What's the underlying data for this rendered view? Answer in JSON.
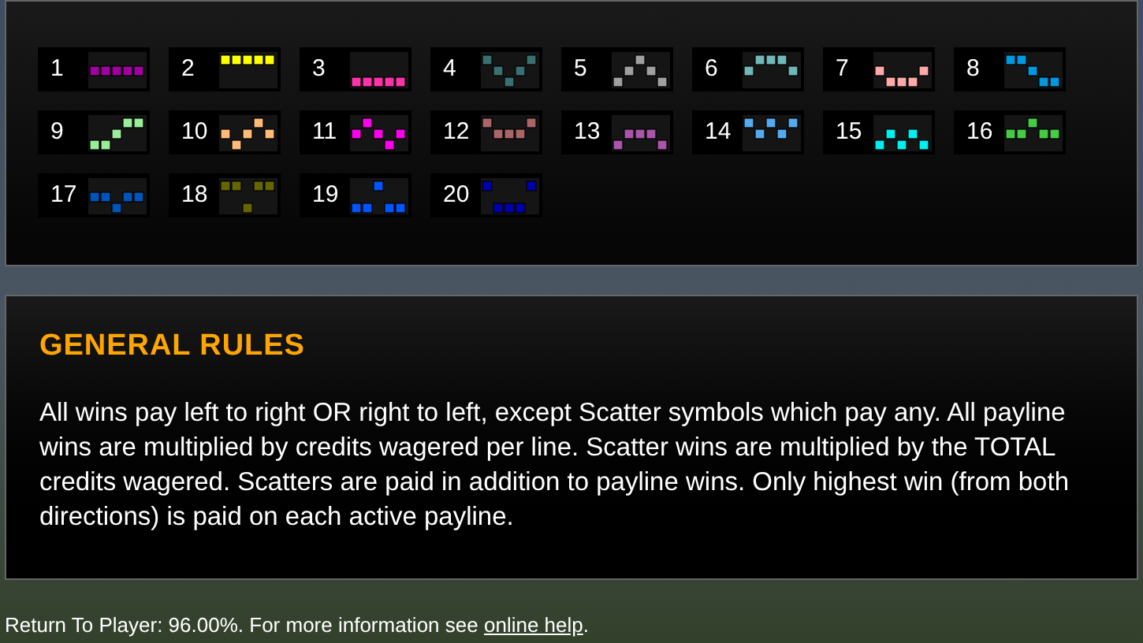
{
  "paylines": [
    {
      "number": "1",
      "color": "#a000a0",
      "squares": [
        {
          "kind": "middle"
        },
        {
          "kind": "middle"
        },
        {
          "kind": "middle"
        },
        {
          "kind": "middle"
        },
        {
          "kind": "middle"
        }
      ]
    },
    {
      "number": "2",
      "color": "#ffff00",
      "squares": [
        {
          "kind": "top"
        },
        {
          "kind": "top"
        },
        {
          "kind": "top"
        },
        {
          "kind": "top"
        },
        {
          "kind": "top"
        }
      ]
    },
    {
      "number": "3",
      "color": "#ff33aa",
      "squares": [
        {
          "kind": "bottom"
        },
        {
          "kind": "bottom"
        },
        {
          "kind": "bottom"
        },
        {
          "kind": "bottom"
        },
        {
          "kind": "bottom"
        }
      ]
    },
    {
      "number": "4",
      "color": "#3a7070",
      "squares": [
        {
          "kind": "top"
        },
        {
          "kind": "middle"
        },
        {
          "kind": "bottom"
        },
        {
          "kind": "middle"
        },
        {
          "kind": "top"
        }
      ]
    },
    {
      "number": "5",
      "color": "#a0a0a0",
      "squares": [
        {
          "kind": "bottom"
        },
        {
          "kind": "middle"
        },
        {
          "kind": "top"
        },
        {
          "kind": "middle"
        },
        {
          "kind": "bottom"
        }
      ]
    },
    {
      "number": "6",
      "color": "#70b8b8",
      "squares": [
        {
          "kind": "middle"
        },
        {
          "kind": "top"
        },
        {
          "kind": "top"
        },
        {
          "kind": "top"
        },
        {
          "kind": "middle"
        }
      ]
    },
    {
      "number": "7",
      "color": "#ffaaaa",
      "squares": [
        {
          "kind": "middle"
        },
        {
          "kind": "bottom"
        },
        {
          "kind": "bottom"
        },
        {
          "kind": "bottom"
        },
        {
          "kind": "middle"
        }
      ]
    },
    {
      "number": "8",
      "color": "#0099e0",
      "squares": [
        {
          "kind": "top"
        },
        {
          "kind": "top"
        },
        {
          "kind": "middle"
        },
        {
          "kind": "bottom"
        },
        {
          "kind": "bottom"
        }
      ]
    },
    {
      "number": "9",
      "color": "#99ee99",
      "squares": [
        {
          "kind": "bottom"
        },
        {
          "kind": "bottom"
        },
        {
          "kind": "middle"
        },
        {
          "kind": "top"
        },
        {
          "kind": "top"
        }
      ]
    },
    {
      "number": "10",
      "color": "#ffbb77",
      "squares": [
        {
          "kind": "middle"
        },
        {
          "kind": "bottom"
        },
        {
          "kind": "middle"
        },
        {
          "kind": "top"
        },
        {
          "kind": "middle"
        }
      ]
    },
    {
      "number": "11",
      "color": "#ff00ee",
      "squares": [
        {
          "kind": "middle"
        },
        {
          "kind": "top"
        },
        {
          "kind": "middle"
        },
        {
          "kind": "bottom"
        },
        {
          "kind": "middle"
        }
      ]
    },
    {
      "number": "12",
      "color": "#aa6666",
      "squares": [
        {
          "kind": "top"
        },
        {
          "kind": "middle"
        },
        {
          "kind": "middle"
        },
        {
          "kind": "middle"
        },
        {
          "kind": "top"
        }
      ]
    },
    {
      "number": "13",
      "color": "#aa55aa",
      "squares": [
        {
          "kind": "bottom"
        },
        {
          "kind": "middle"
        },
        {
          "kind": "middle"
        },
        {
          "kind": "middle"
        },
        {
          "kind": "bottom"
        }
      ]
    },
    {
      "number": "14",
      "color": "#55aaee",
      "squares": [
        {
          "kind": "top"
        },
        {
          "kind": "middle"
        },
        {
          "kind": "top"
        },
        {
          "kind": "middle"
        },
        {
          "kind": "top"
        }
      ]
    },
    {
      "number": "15",
      "color": "#00f0f0",
      "squares": [
        {
          "kind": "bottom"
        },
        {
          "kind": "middle"
        },
        {
          "kind": "bottom"
        },
        {
          "kind": "middle"
        },
        {
          "kind": "bottom"
        }
      ]
    },
    {
      "number": "16",
      "color": "#44cc44",
      "squares": [
        {
          "kind": "middle"
        },
        {
          "kind": "middle"
        },
        {
          "kind": "top"
        },
        {
          "kind": "middle"
        },
        {
          "kind": "middle"
        }
      ]
    },
    {
      "number": "17",
      "color": "#0055bb",
      "squares": [
        {
          "kind": "middle"
        },
        {
          "kind": "middle"
        },
        {
          "kind": "bottom"
        },
        {
          "kind": "middle"
        },
        {
          "kind": "middle"
        }
      ]
    },
    {
      "number": "18",
      "color": "#666600",
      "squares": [
        {
          "kind": "top"
        },
        {
          "kind": "top"
        },
        {
          "kind": "bottom"
        },
        {
          "kind": "top"
        },
        {
          "kind": "top"
        }
      ]
    },
    {
      "number": "19",
      "color": "#0055ff",
      "squares": [
        {
          "kind": "bottom"
        },
        {
          "kind": "bottom"
        },
        {
          "kind": "top"
        },
        {
          "kind": "bottom"
        },
        {
          "kind": "bottom"
        }
      ]
    },
    {
      "number": "20",
      "color": "#0000aa",
      "squares": [
        {
          "kind": "top"
        },
        {
          "kind": "bottom"
        },
        {
          "kind": "bottom"
        },
        {
          "kind": "bottom"
        },
        {
          "kind": "top"
        }
      ]
    }
  ],
  "rules": {
    "title": "GENERAL RULES",
    "text": "All wins pay left to right OR right to left, except Scatter symbols which pay any. All payline wins are multiplied by credits wagered per line. Scatter wins are multiplied by the TOTAL credits wagered. Scatters are paid in addition to payline wins. Only highest win (from both directions) is paid on each active payline."
  },
  "footer": {
    "text": "Return To Player: 96.00%. For more information see",
    "link": "online help",
    "end": "."
  }
}
